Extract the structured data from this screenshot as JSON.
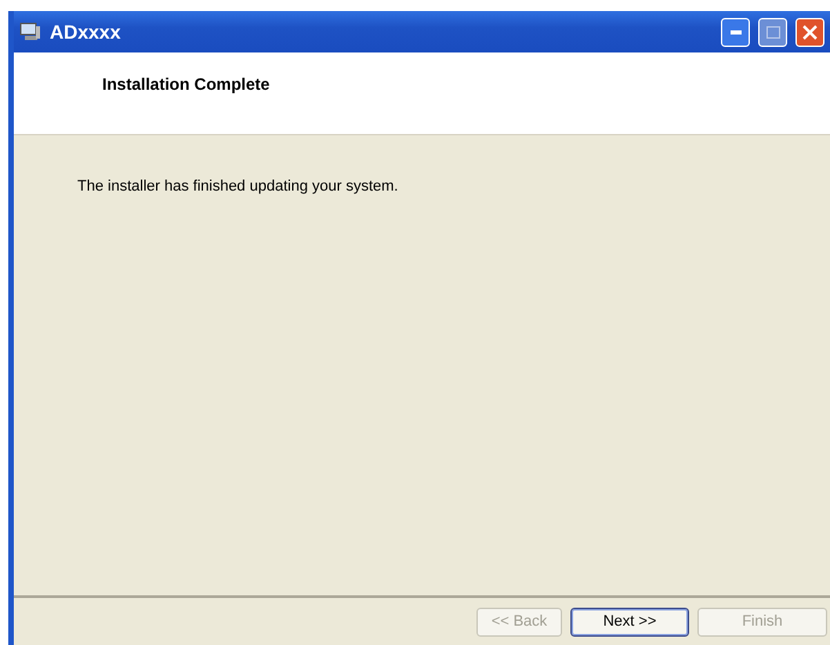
{
  "window": {
    "title": "ADxxxx"
  },
  "header": {
    "title": "Installation Complete"
  },
  "body": {
    "message": "The installer has finished updating your system."
  },
  "buttons": [
    {
      "label": "<< Back",
      "disabled": true,
      "focused": false
    },
    {
      "label": "Next >>",
      "disabled": false,
      "focused": true
    },
    {
      "label": "Finish",
      "disabled": true,
      "focused": false
    }
  ]
}
